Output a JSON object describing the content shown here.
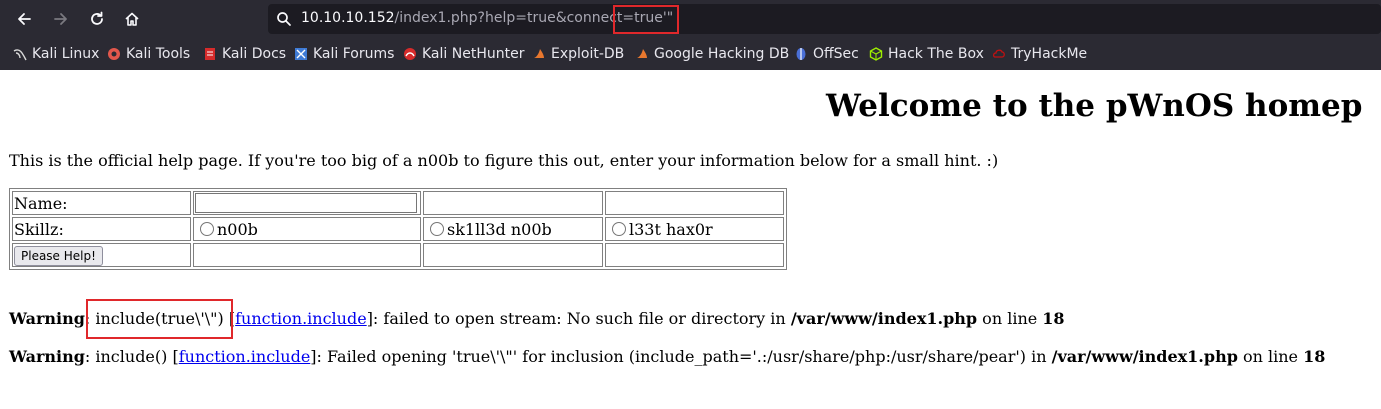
{
  "browser": {
    "url_host": "10.10.10.152",
    "url_path": "/index1.php?help=true&connect=",
    "url_param": "true'\"",
    "bookmarks": [
      {
        "label": "Kali Linux",
        "icon": "kali-dragon-icon",
        "color": "#d9d9d9"
      },
      {
        "label": "Kali Tools",
        "icon": "kali-tools-icon",
        "color": "#e2574c"
      },
      {
        "label": "Kali Docs",
        "icon": "kali-docs-icon",
        "color": "#d62b2b"
      },
      {
        "label": "Kali Forums",
        "icon": "kali-forums-icon",
        "color": "#3f7bd6"
      },
      {
        "label": "Kali NetHunter",
        "icon": "nethunter-icon",
        "color": "#d62b2b"
      },
      {
        "label": "Exploit-DB",
        "icon": "exploit-db-icon",
        "color": "#e8772e"
      },
      {
        "label": "Google Hacking DB",
        "icon": "ghdb-icon",
        "color": "#e8772e"
      },
      {
        "label": "OffSec",
        "icon": "offsec-icon",
        "color": "#4a6fd6"
      },
      {
        "label": "Hack The Box",
        "icon": "htb-icon",
        "color": "#9fef00"
      },
      {
        "label": "TryHackMe",
        "icon": "tryhackme-icon",
        "color": "#c11111"
      }
    ]
  },
  "page": {
    "title": "Welcome to the pWnOS homep",
    "intro": "This is the official help page. If you're too big of a n00b to figure this out, enter your information below for a small hint. :)",
    "form": {
      "name_label": "Name:",
      "skill_label": "Skillz:",
      "options": [
        "n00b",
        "sk1ll3d n00b",
        "l33t hax0r"
      ],
      "submit_label": "Please Help!"
    },
    "warnings": [
      {
        "label": "Warning",
        "pre": ": include(true\\'\\\") [",
        "link": "function.include",
        "post": "]: failed to open stream: No such file or directory in ",
        "file": "/var/www/index1.php",
        "line_text": " on line ",
        "line": "18"
      },
      {
        "label": "Warning",
        "pre": ": include() [",
        "link": "function.include",
        "post": "]: Failed opening 'true\\'\\\"' for inclusion (include_path='.:/usr/share/php:/usr/share/pear') in ",
        "file": "/var/www/index1.php",
        "line_text": " on line ",
        "line": "18"
      }
    ]
  },
  "colors": {
    "highlight_box": "#e0282b",
    "link": "#0000ee",
    "chrome_bg": "#2b2a33"
  }
}
